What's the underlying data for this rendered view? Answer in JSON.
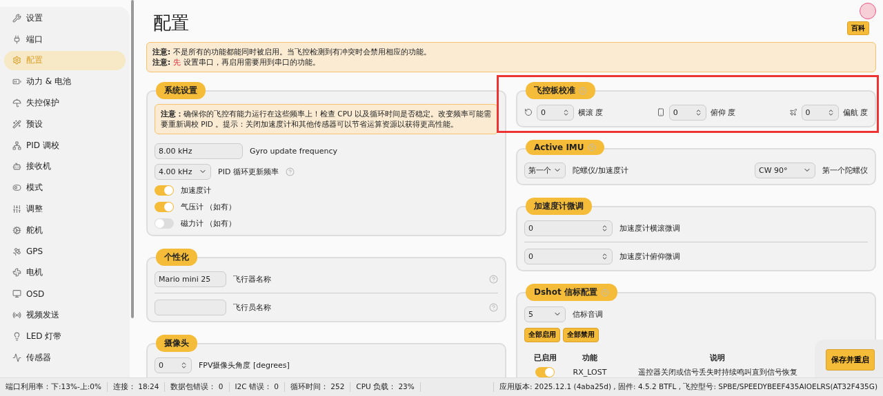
{
  "sidebar": {
    "items": [
      {
        "label": "设置",
        "selected": false
      },
      {
        "label": "端口",
        "selected": false
      },
      {
        "label": "配置",
        "selected": true
      },
      {
        "label": "动力 & 电池",
        "selected": false
      },
      {
        "label": "失控保护",
        "selected": false
      },
      {
        "label": "预设",
        "selected": false
      },
      {
        "label": "PID 调校",
        "selected": false
      },
      {
        "label": "接收机",
        "selected": false
      },
      {
        "label": "模式",
        "selected": false
      },
      {
        "label": "调整",
        "selected": false
      },
      {
        "label": "舵机",
        "selected": false
      },
      {
        "label": "GPS",
        "selected": false
      },
      {
        "label": "电机",
        "selected": false
      },
      {
        "label": "OSD",
        "selected": false
      },
      {
        "label": "视频发送",
        "selected": false
      },
      {
        "label": "LED 灯带",
        "selected": false
      },
      {
        "label": "传感器",
        "selected": false
      }
    ]
  },
  "header": {
    "title": "配置",
    "wiki_button": "百科"
  },
  "notice": [
    {
      "label": "注意:",
      "text": "不是所有的功能都能同时被启用。当飞控检测到有冲突时会禁用相应的功能。"
    },
    {
      "label": "注意:",
      "highlight": "先",
      "text": "设置串口，再启用需要用到串口的功能。"
    }
  ],
  "system": {
    "title": "系统设置",
    "warning": "**注意：**确保你的飞控有能力运行在这些频率上！检查 CPU 以及循环时间是否稳定。改变频率可能需要重新调校 PID 。提示：关闭加速度计和其他传感器可以节省运算资源以获得更高性能。",
    "gyro": {
      "value": "8.00 kHz",
      "label": "Gyro update frequency"
    },
    "pid": {
      "value": "4.00 kHz",
      "label": "PID 循环更新频率"
    },
    "toggles": [
      {
        "label": "加速度计",
        "on": true
      },
      {
        "label": "气压计 （如有）",
        "on": true
      },
      {
        "label": "磁力计 （如有）",
        "on": false
      }
    ]
  },
  "personal": {
    "title": "个性化",
    "fields": [
      {
        "value": "Mario mini 25",
        "label": "飞行器名称"
      },
      {
        "label": "飞行员名称"
      }
    ]
  },
  "camera": {
    "title": "摄像头",
    "angle": {
      "value": "0",
      "label": "FPV摄像头角度 [degrees]"
    }
  },
  "board_alignment": {
    "title": "飞控板校准",
    "highlighted": true,
    "axes": [
      {
        "input": "0",
        "unit_label": "横滚 度"
      },
      {
        "input": "0",
        "unit_label": "俯仰 度"
      },
      {
        "input": "0",
        "unit_label": "偏航 度"
      }
    ]
  },
  "active_imu": {
    "title": "Active IMU",
    "imu": {
      "value": "第一个",
      "label": "陀螺仪/加速度计"
    },
    "orientation": {
      "value": "CW 90°",
      "label": "第一个陀螺仪"
    }
  },
  "acc_trim": {
    "title": "加速度计微调",
    "fields": [
      {
        "value": "0",
        "label": "加速度计横滚微调"
      },
      {
        "value": "0",
        "label": "加速度计俯仰微调"
      }
    ]
  },
  "dshot": {
    "title": "Dshot 信标配置",
    "tone": {
      "value": "5",
      "label": "信标音调"
    },
    "buttons": [
      "全部启用",
      "全部禁用"
    ],
    "columns": [
      "已启用",
      "功能",
      "说明"
    ],
    "rows": [
      {
        "on": true,
        "function": "RX_LOST",
        "description": "遥控器关闭或信号丢失时持续鸣叫直到信号恢复"
      }
    ]
  },
  "save_button": "保存并重启",
  "status_bar": [
    "端口利用率：下:13%-上:0%",
    "连接： 18:24",
    "数据包错误： 0",
    "I2C 错误： 0",
    "循环时间： 252",
    "CPU 负载： 23%"
  ],
  "status_version": "应用版本: 2025.12.1 (4aba25d) , 固件: 4.5.2 BTFL , 飞控型号: SPBE/SPEEDYBEEF435AIOELRS(AT32F435G)"
}
